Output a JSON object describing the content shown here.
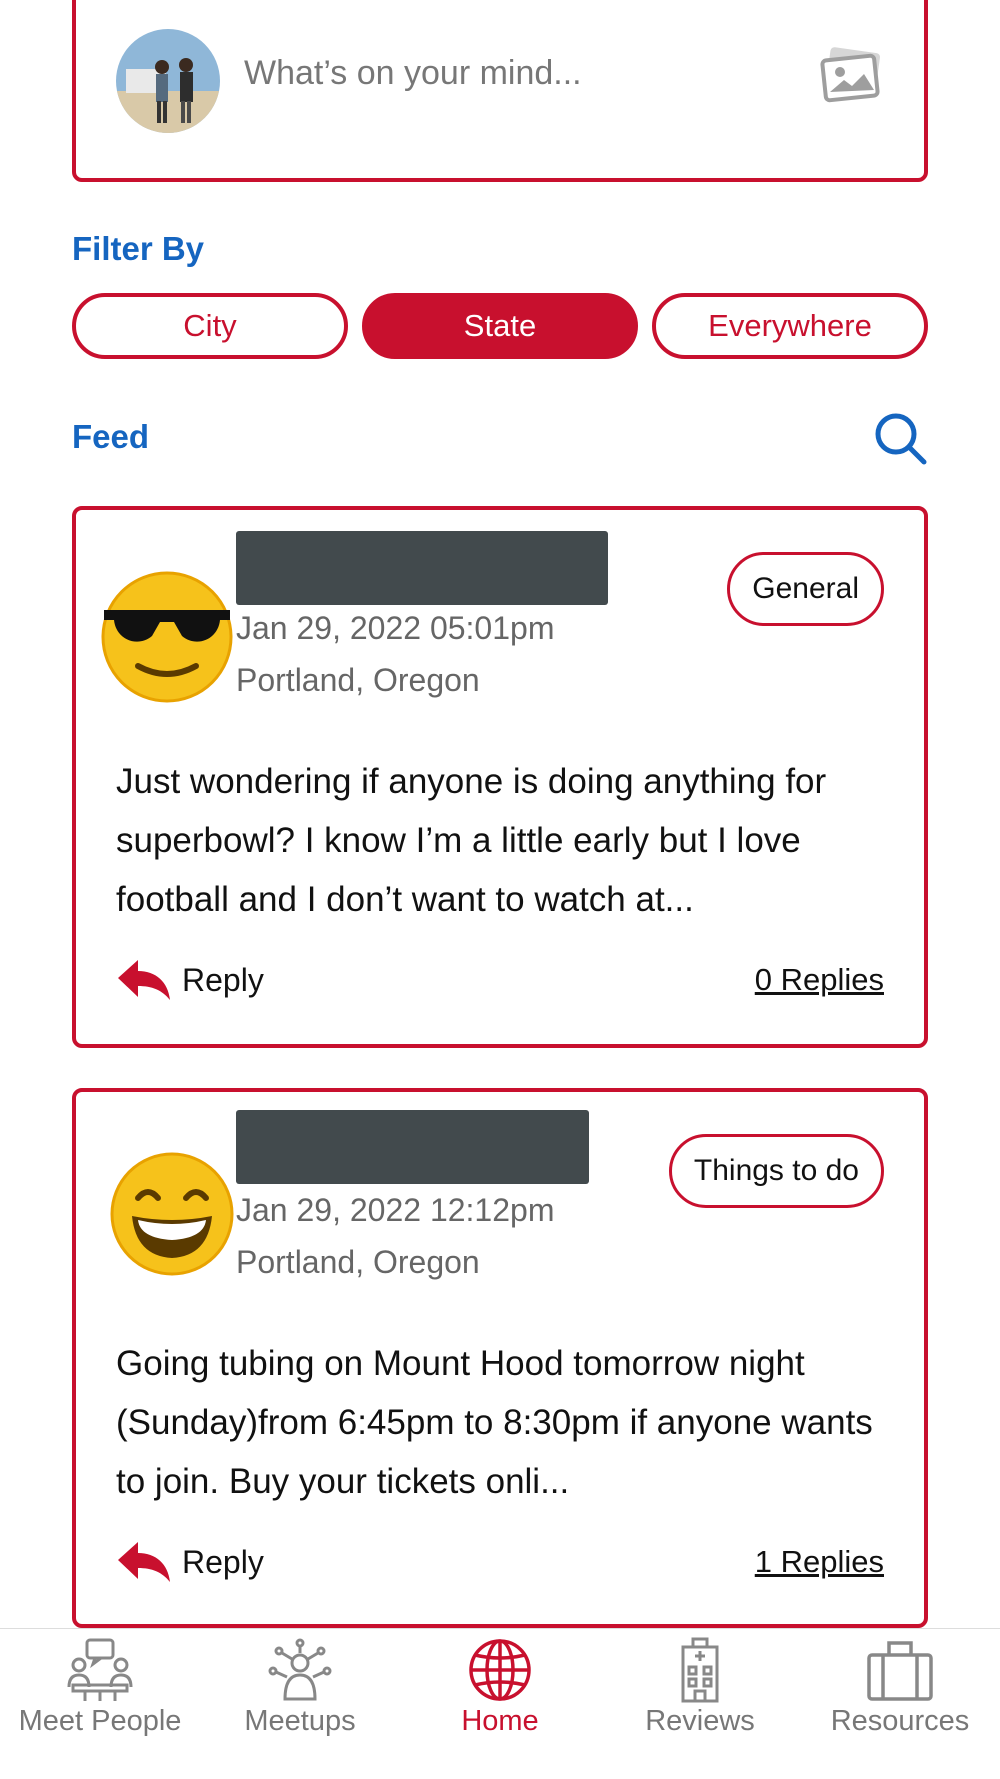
{
  "composer": {
    "placeholder": "What’s on your mind...",
    "avatar_icon": "user-avatar-photo",
    "photo_icon": "image-upload-icon"
  },
  "filter": {
    "title": "Filter By",
    "options": [
      "City",
      "State",
      "Everywhere"
    ],
    "selected": "State"
  },
  "feed": {
    "title": "Feed",
    "search_icon": "search-icon",
    "posts": [
      {
        "emoji": "sunglasses-emoji",
        "date": "Jan 29, 2022 05:01pm",
        "location": "Portland, Oregon",
        "tag": "General",
        "body": "Just wondering if anyone is doing anything for superbowl? I know I’m a little early but I love football and I don’t want to watch at...",
        "reply_label": "Reply",
        "replies": "0 Replies"
      },
      {
        "emoji": "grinning-emoji",
        "date": "Jan 29, 2022 12:12pm",
        "location": "Portland, Oregon",
        "tag": "Things to do",
        "body": "Going tubing on Mount Hood tomorrow night (Sunday)from 6:45pm to 8:30pm if anyone wants to join. Buy your tickets onli...",
        "reply_label": "Reply",
        "replies": "1 Replies"
      }
    ]
  },
  "bottom_nav": {
    "items": [
      {
        "label": "Meet People",
        "icon": "meet-people-icon"
      },
      {
        "label": "Meetups",
        "icon": "meetups-icon"
      },
      {
        "label": "Home",
        "icon": "globe-icon"
      },
      {
        "label": "Reviews",
        "icon": "building-icon"
      },
      {
        "label": "Resources",
        "icon": "briefcase-icon"
      }
    ],
    "active": "Home"
  },
  "colors": {
    "accent": "#c8102e",
    "heading": "#1565c0",
    "name_redaction": "#424a4d"
  }
}
